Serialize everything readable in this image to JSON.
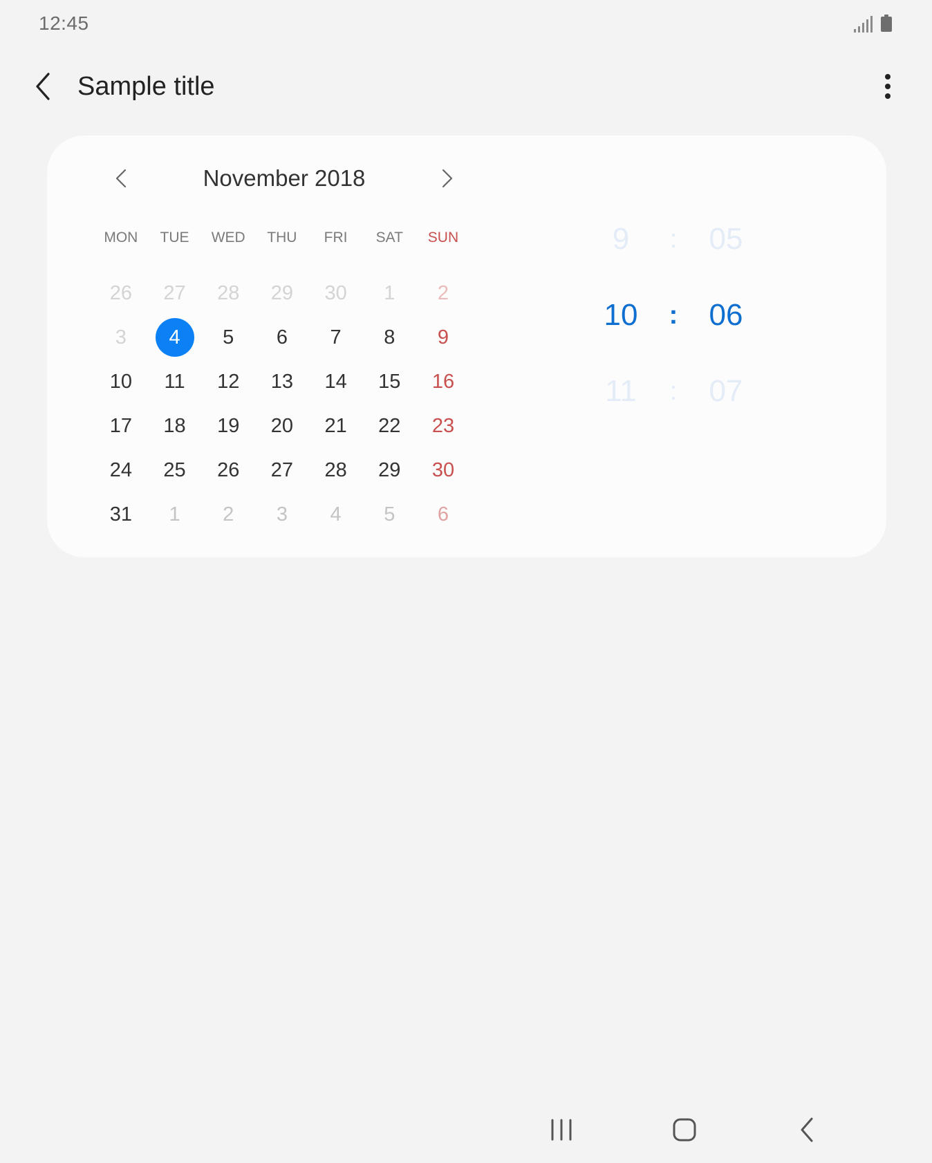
{
  "status_bar": {
    "time": "12:45",
    "icons": [
      "signal-icon",
      "battery-icon"
    ]
  },
  "app_bar": {
    "title": "Sample title",
    "icons": [
      "back-arrow-icon",
      "more-vertical-icon"
    ]
  },
  "calendar": {
    "month_title": "November 2018",
    "weekdays": [
      "MON",
      "TUE",
      "WED",
      "THU",
      "FRI",
      "SAT",
      "SUN"
    ],
    "weeks": [
      [
        "26",
        "27",
        "28",
        "29",
        "30",
        "1",
        "2"
      ],
      [
        "3",
        "4",
        "5",
        "6",
        "7",
        "8",
        "9"
      ],
      [
        "10",
        "11",
        "12",
        "13",
        "14",
        "15",
        "16"
      ],
      [
        "17",
        "18",
        "19",
        "20",
        "21",
        "22",
        "23"
      ],
      [
        "24",
        "25",
        "26",
        "27",
        "28",
        "29",
        "30"
      ],
      [
        "31",
        "1",
        "2",
        "3",
        "4",
        "5",
        "6"
      ]
    ],
    "selected_day": "4",
    "colors": {
      "accent": "#0b81f5",
      "sunday": "#c8504e",
      "text": "#333333"
    }
  },
  "time_picker": {
    "rows": [
      {
        "hour": "9",
        "separator": ":",
        "minute": "05"
      },
      {
        "hour": "10",
        "separator": ":",
        "minute": "06"
      },
      {
        "hour": "11",
        "separator": ":",
        "minute": "07"
      }
    ],
    "selected_hour": "10",
    "selected_minute": "06",
    "colors": {
      "selected": "#0e6fd1",
      "faded": "#e4ecf7"
    }
  },
  "nav_bar": {
    "icons": [
      "recents-icon",
      "home-icon",
      "back-icon"
    ]
  }
}
